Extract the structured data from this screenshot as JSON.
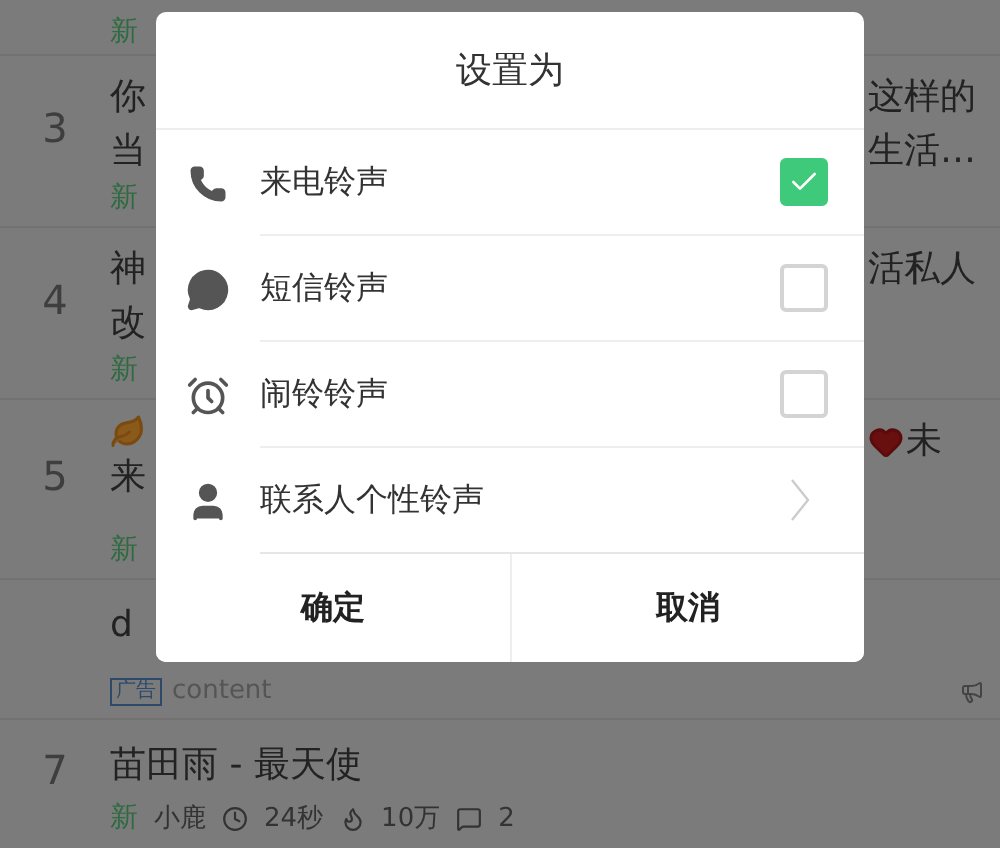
{
  "list": {
    "rows": [
      {
        "kind": "partial",
        "left_lines": [],
        "right_lines": [],
        "meta": "新"
      },
      {
        "kind": "partial",
        "number": "3",
        "left_lines": [
          "你",
          "当"
        ],
        "right_lines": [
          "这样的",
          "生活…"
        ],
        "meta": "新"
      },
      {
        "kind": "partial",
        "number": "4",
        "left_lines": [
          "神",
          "改"
        ],
        "right_lines": [
          "活私人"
        ],
        "meta": "新"
      },
      {
        "kind": "partial-emoji",
        "number": "5",
        "left_lines": [
          "来"
        ],
        "right_lines": [
          "未"
        ],
        "meta": "新"
      },
      {
        "kind": "ad",
        "title": "d",
        "tag": "广告",
        "caption": "content"
      },
      {
        "kind": "song",
        "number": "7",
        "title": "苗田雨 - 最天使",
        "meta": "新",
        "author": "小鹿",
        "duration": "24秒",
        "plays": "10万",
        "comments": "2"
      }
    ]
  },
  "dialog": {
    "title": "设置为",
    "options": [
      {
        "kind": "checkbox",
        "label": "来电铃声",
        "checked": true
      },
      {
        "kind": "checkbox",
        "label": "短信铃声",
        "checked": false
      },
      {
        "kind": "checkbox",
        "label": "闹铃铃声",
        "checked": false
      },
      {
        "kind": "link",
        "label": "联系人个性铃声"
      }
    ],
    "buttons": [
      "确定",
      "取消"
    ]
  }
}
